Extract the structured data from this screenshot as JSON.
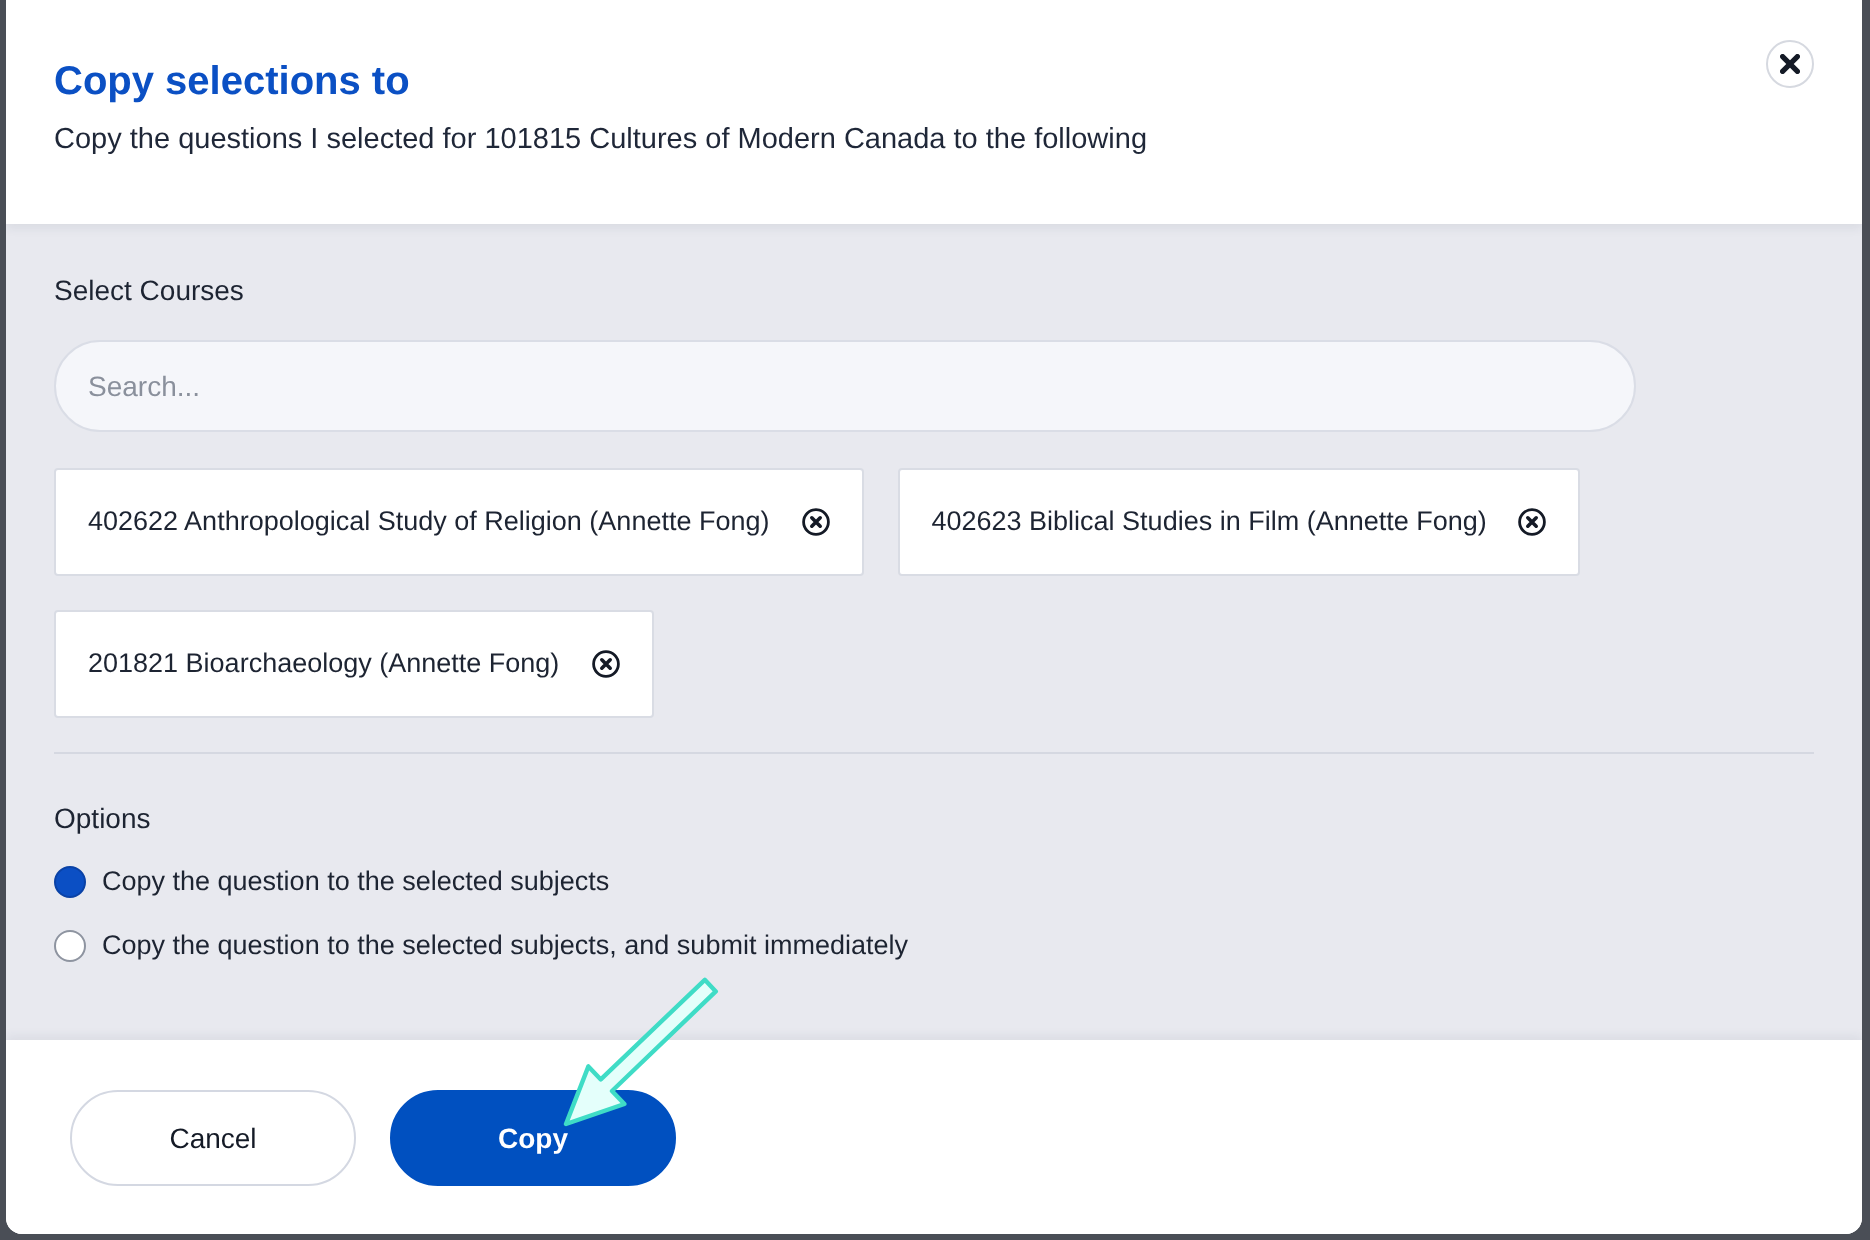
{
  "dialog": {
    "title": "Copy selections to",
    "subtitle": "Copy the questions I selected for 101815 Cultures of Modern Canada to the following"
  },
  "courses": {
    "label": "Select Courses",
    "search": {
      "placeholder": "Search..."
    },
    "chips": [
      {
        "name": "402622 Anthropological Study of Religion (Annette Fong)"
      },
      {
        "name": "402623 Biblical Studies in Film (Annette Fong)"
      },
      {
        "name": "201821 Bioarchaeology (Annette Fong)"
      }
    ]
  },
  "options": {
    "label": "Options",
    "choices": [
      {
        "label": "Copy the question to the selected subjects",
        "selected": true
      },
      {
        "label": "Copy the question to the selected subjects, and submit immediately",
        "selected": false
      }
    ]
  },
  "buttons": [
    {
      "label": "Cancel",
      "kind": "secondary"
    },
    {
      "label": "Copy",
      "kind": "primary"
    }
  ]
}
